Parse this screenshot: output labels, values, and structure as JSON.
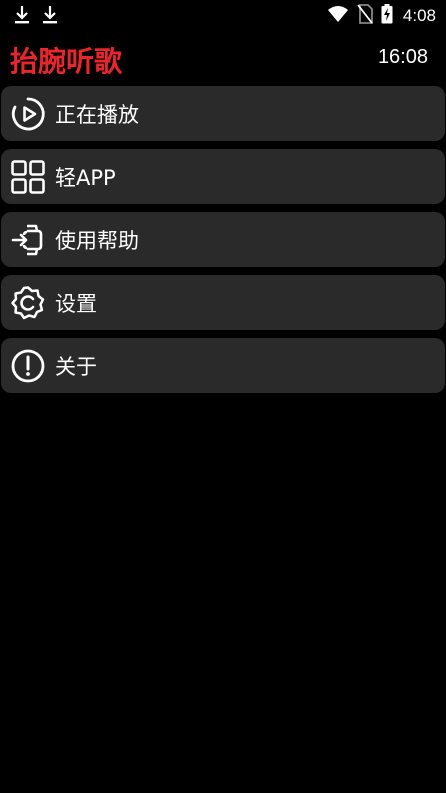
{
  "status_bar": {
    "time": "4:08",
    "left_icons": [
      "download-icon",
      "download-icon"
    ],
    "right_icons": [
      "wifi-icon",
      "no-sim-icon",
      "battery-charging-icon"
    ]
  },
  "header": {
    "title": "抬腕听歌",
    "clock": "16:08",
    "title_color": "#e8262b"
  },
  "menu": {
    "items": [
      {
        "label": "正在播放",
        "icon": "play-circle-icon"
      },
      {
        "label": "轻APP",
        "icon": "apps-grid-icon"
      },
      {
        "label": "使用帮助",
        "icon": "watch-login-icon"
      },
      {
        "label": "设置",
        "icon": "settings-icon"
      },
      {
        "label": "关于",
        "icon": "info-alert-icon"
      }
    ]
  },
  "colors": {
    "background": "#000000",
    "item_background": "#2a2a2a",
    "text": "#ffffff"
  }
}
